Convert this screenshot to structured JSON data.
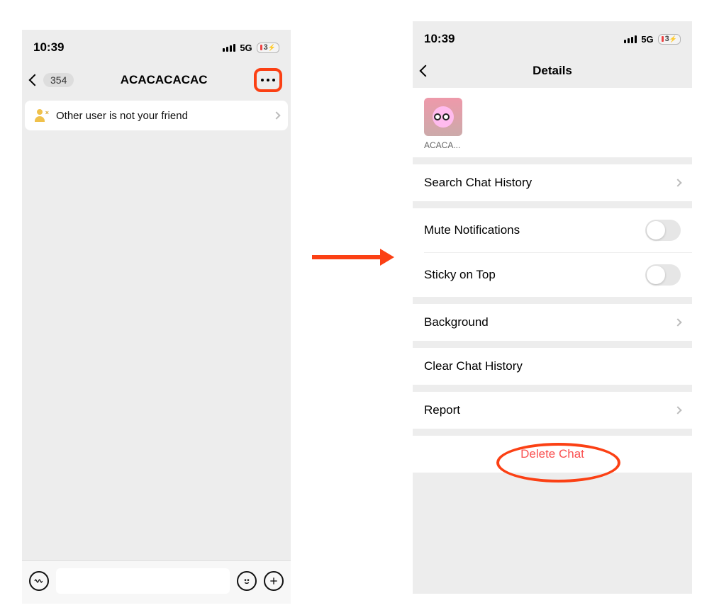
{
  "status": {
    "time": "10:39",
    "network": "5G",
    "battery_text": "3"
  },
  "left": {
    "back_count": "354",
    "title": "ACACACACAC",
    "notice": "Other user is not your friend"
  },
  "right": {
    "title": "Details",
    "avatar_name": "ACACA...",
    "rows": {
      "search": "Search Chat History",
      "mute": "Mute Notifications",
      "sticky": "Sticky on Top",
      "background": "Background",
      "clear": "Clear Chat History",
      "report": "Report",
      "delete": "Delete Chat"
    }
  }
}
